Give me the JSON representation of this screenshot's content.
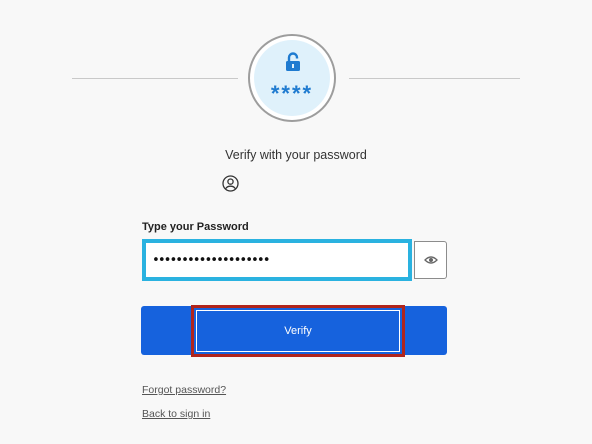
{
  "header": {
    "badge_text": "****",
    "badge_icon": "unlocked-padlock-icon",
    "accent_color": "#1f7bd0"
  },
  "main": {
    "title": "Verify with your password",
    "user_icon": "user-circle-icon",
    "password_label": "Type your Password",
    "password_value": "••••••••••••••••••••",
    "show_password_icon": "eye-icon",
    "verify_label": "Verify",
    "verify_color": "#1662dd"
  },
  "links": {
    "forgot_password": "Forgot password?",
    "back_to_sign_in": "Back to sign in"
  }
}
